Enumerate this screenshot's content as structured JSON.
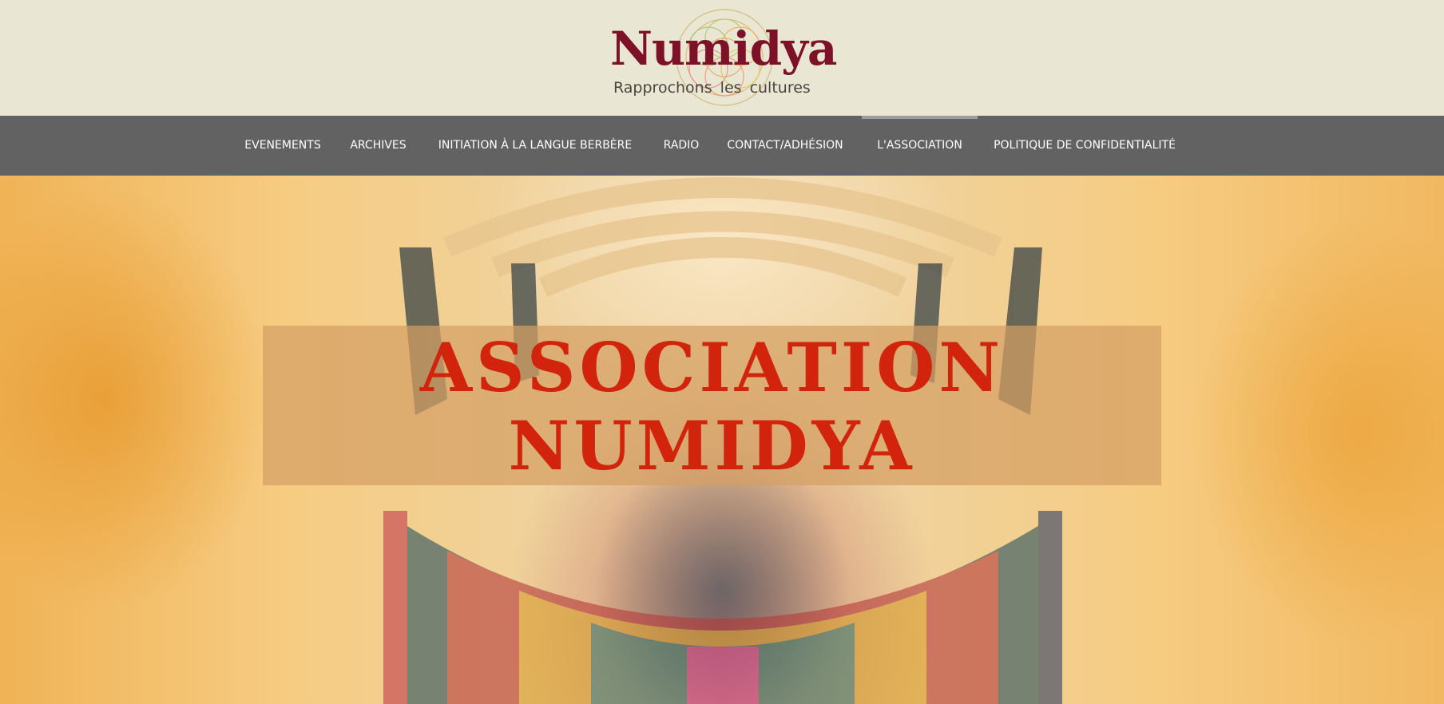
{
  "logo": {
    "name": "Numidya",
    "tagline": "Rapprochons les cultures"
  },
  "nav": {
    "items": [
      {
        "label": "EVENEMENTS"
      },
      {
        "label": "ARCHIVES"
      },
      {
        "label": "INITIATION À LA LANGUE BERBÈRE"
      },
      {
        "label": "RADIO"
      },
      {
        "label": "CONTACT/ADHÉSION"
      },
      {
        "label": "L'ASSOCIATION",
        "active": true
      },
      {
        "label": "POLITIQUE DE CONFIDENTIALITÉ"
      }
    ]
  },
  "hero": {
    "title": "ASSOCIATION\nNUMIDYA",
    "image": "colorful-hanging-fabrics-photo"
  },
  "colors": {
    "header_bg": "#e9e7d4",
    "nav_bg": "#626262",
    "logo_red": "#7d1127",
    "title_red": "#d2230c"
  }
}
